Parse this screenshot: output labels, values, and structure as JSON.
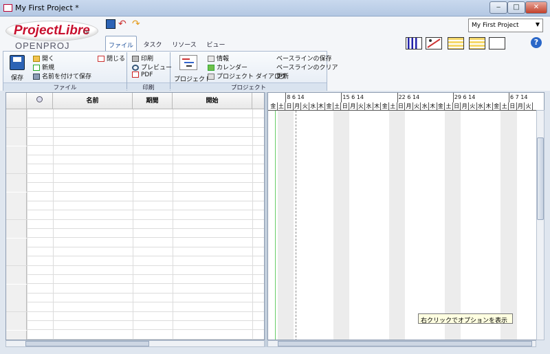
{
  "window": {
    "title": "My First Project *",
    "min": "‒",
    "max": "□",
    "close": "✕"
  },
  "logo": {
    "main": "ProjectLibre",
    "tm": "TM",
    "sub": "OPENPROJ"
  },
  "project_selector": {
    "value": "My First Project"
  },
  "tabs": [
    {
      "label": "ファイル"
    },
    {
      "label": "タスク"
    },
    {
      "label": "リソース"
    },
    {
      "label": "ビュー"
    }
  ],
  "ribbon": {
    "file": {
      "save": "保存",
      "open": "開く",
      "new": "新規",
      "save_as": "名前を付けて保存",
      "close": "閉じる",
      "group": "ファイル"
    },
    "print": {
      "print": "印刷",
      "preview": "プレビュー",
      "pdf": "PDF",
      "group": "印刷"
    },
    "project": {
      "project": "プロジェクト",
      "info": "情報",
      "calendar": "カレンダー",
      "dialog": "プロジェクト ダイアログ",
      "baseline_save": "ベースラインの保存",
      "baseline_clear": "ベースラインのクリア",
      "update": "更新",
      "group": "プロジェクト"
    }
  },
  "grid": {
    "columns": [
      "名前",
      "期間",
      "開始"
    ]
  },
  "gantt": {
    "weeks": [
      "8 6 14",
      "15 6 14",
      "22 6 14",
      "29 6 14",
      "6 7 14"
    ],
    "days_first": [
      "金",
      "土"
    ],
    "days": [
      "日",
      "月",
      "火",
      "水",
      "木",
      "金",
      "土"
    ]
  },
  "tooltip": "右クリックでオプションを表示",
  "colors": {
    "accent": "#1a4d99",
    "logo_red": "#c8102e"
  }
}
